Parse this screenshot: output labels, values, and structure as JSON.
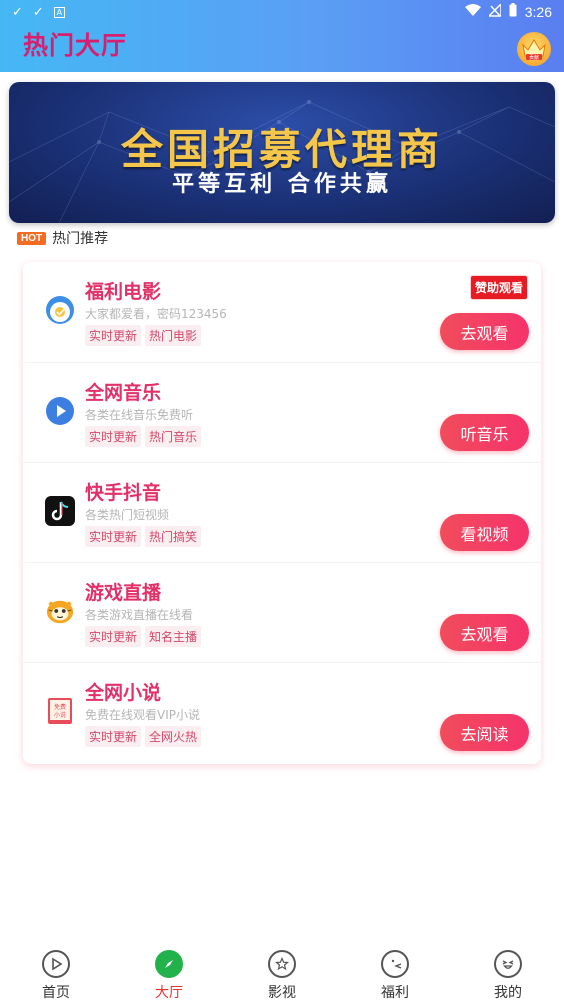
{
  "status_bar": {
    "time": "3:26"
  },
  "header": {
    "title": "热门大厅",
    "badge_text": "贡献"
  },
  "banner": {
    "title": "全国招募代理商",
    "subtitle": "平等互利 合作共赢"
  },
  "section": {
    "badge": "HOT",
    "title": "热门推荐"
  },
  "items": [
    {
      "name": "福利电影",
      "desc": "大家都爱看，密码123456",
      "tags": [
        "实时更新",
        "热门电影"
      ],
      "action": "去观看",
      "sponsor": "赞助观看",
      "icon": "movie-icon"
    },
    {
      "name": "全网音乐",
      "desc": "各类在线音乐免费听",
      "tags": [
        "实时更新",
        "热门音乐"
      ],
      "action": "听音乐",
      "icon": "music-play-icon"
    },
    {
      "name": "快手抖音",
      "desc": "各类热门短视频",
      "tags": [
        "实时更新",
        "热门搞笑"
      ],
      "action": "看视频",
      "icon": "tiktok-icon"
    },
    {
      "name": "游戏直播",
      "desc": "各类游戏直播在线看",
      "tags": [
        "实时更新",
        "知名主播"
      ],
      "action": "去观看",
      "icon": "game-tiger-icon"
    },
    {
      "name": "全网小说",
      "desc": "免费在线观看VIP小说",
      "tags": [
        "实时更新",
        "全网火热"
      ],
      "action": "去阅读",
      "icon": "novel-book-icon"
    }
  ],
  "novel_icon_text": [
    "免费",
    "小说"
  ],
  "tabs": [
    {
      "label": "首页",
      "icon": "play-circle-icon"
    },
    {
      "label": "大厅",
      "icon": "compass-icon",
      "active": true
    },
    {
      "label": "影视",
      "icon": "tv-star-icon"
    },
    {
      "label": "福利",
      "icon": "pacman-icon"
    },
    {
      "label": "我的",
      "icon": "smile-face-icon"
    }
  ],
  "colors": {
    "accent": "#e23068",
    "header_start": "#45b8f4",
    "header_end": "#5a7ef0",
    "action": "#f14c5c"
  }
}
